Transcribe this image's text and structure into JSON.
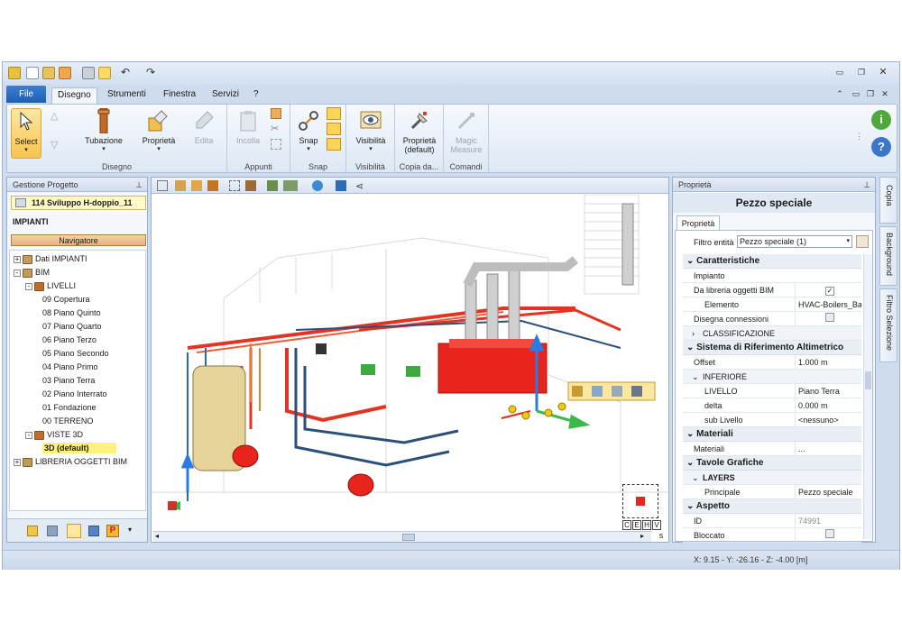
{
  "quick_access": {
    "icons": [
      "app-icon",
      "new-icon",
      "open-icon",
      "save-icon",
      "print-icon",
      "select-icon",
      "undo-icon",
      "redo-icon"
    ]
  },
  "tabs": {
    "file": "File",
    "items": [
      "Disegno",
      "Strumenti",
      "Finestra",
      "Servizi",
      "?"
    ]
  },
  "ribbon": {
    "select": "Select",
    "tubazione": "Tubazione",
    "proprieta": "Proprietà",
    "edita": "Edita",
    "disegno_group": "Disegno",
    "incolla": "Incolla",
    "appunti_group": "Appunti",
    "snap": "Snap",
    "snap_group": "Snap",
    "visibilita": "Visibilità",
    "visibilita_group": "Visibilità",
    "proprieta_default_1": "Proprietà",
    "proprieta_default_2": "(default)",
    "copia_group": "Copia da...",
    "magic_1": "Magic",
    "magic_2": "Measure",
    "comandi_group": "Comandi"
  },
  "project_panel": {
    "title": "Gestione Progetto",
    "project_name": "114 Sviluppo H-doppio_11",
    "section": "IMPIANTI",
    "navigator": "Navigatore",
    "tree": [
      {
        "label": "Dati IMPIANTI",
        "level": 0,
        "exp": "+"
      },
      {
        "label": "BIM",
        "level": 0,
        "exp": "-"
      },
      {
        "label": "LIVELLI",
        "level": 1,
        "exp": "-"
      },
      {
        "label": "09 Copertura",
        "level": 2,
        "exp": ""
      },
      {
        "label": "08 Piano Quinto",
        "level": 2,
        "exp": ""
      },
      {
        "label": "07 Piano Quarto",
        "level": 2,
        "exp": ""
      },
      {
        "label": "06 Piano Terzo",
        "level": 2,
        "exp": ""
      },
      {
        "label": "05 Piano Secondo",
        "level": 2,
        "exp": ""
      },
      {
        "label": "04 Piano Primo",
        "level": 2,
        "exp": ""
      },
      {
        "label": "03 Piano Terra",
        "level": 2,
        "exp": ""
      },
      {
        "label": "02 Piano Interrato",
        "level": 2,
        "exp": ""
      },
      {
        "label": "01 Fondazione",
        "level": 2,
        "exp": ""
      },
      {
        "label": "00 TERRENO",
        "level": 2,
        "exp": ""
      },
      {
        "label": "VISTE 3D",
        "level": 1,
        "exp": "-"
      },
      {
        "label": "3D (default)",
        "level": 2,
        "exp": "",
        "selected": true
      },
      {
        "label": "LIBRERIA OGGETTI BIM",
        "level": 0,
        "exp": "+"
      }
    ]
  },
  "viewport": {
    "scroll_label": "s",
    "cube_faces": [
      "C",
      "E",
      "H",
      "V"
    ]
  },
  "properties": {
    "panel_title": "Proprietà",
    "heading": "Pezzo speciale",
    "tab": "Proprietà",
    "filter_label": "Filtro entità",
    "filter_value": "Pezzo speciale (1)",
    "rows": [
      {
        "type": "cat",
        "label": "Caratteristiche"
      },
      {
        "type": "row",
        "k": "Impianto",
        "v": ""
      },
      {
        "type": "row",
        "k": "Da libreria oggetti BIM",
        "v": "✓",
        "chk": true
      },
      {
        "type": "row",
        "k": "Elemento",
        "v": "HVAC-Boilers_Baxi_",
        "ind": 1
      },
      {
        "type": "row",
        "k": "Disegna connessioni",
        "v": "",
        "chk": true
      },
      {
        "type": "sub",
        "k": "CLASSIFICAZIONE",
        "v": "",
        "exp": ">"
      },
      {
        "type": "cat",
        "label": "Sistema di Riferimento Altimetrico"
      },
      {
        "type": "row",
        "k": "Offset",
        "v": "1.000 m"
      },
      {
        "type": "sub",
        "k": "INFERIORE",
        "v": "",
        "exp": "v"
      },
      {
        "type": "row",
        "k": "LIVELLO",
        "v": "Piano Terra",
        "ind": 1
      },
      {
        "type": "row",
        "k": "delta",
        "v": "0.000 m",
        "ind": 1
      },
      {
        "type": "row",
        "k": "sub Livello",
        "v": "<nessuno>",
        "ind": 1
      },
      {
        "type": "cat",
        "label": "Materiali"
      },
      {
        "type": "row",
        "k": "Materiali",
        "v": "..."
      },
      {
        "type": "cat",
        "label": "Tavole Grafiche"
      },
      {
        "type": "sub",
        "k": "LAYERS",
        "v": "",
        "exp": "v",
        "bold": true
      },
      {
        "type": "row",
        "k": "Principale",
        "v": "Pezzo speciale",
        "ind": 1
      },
      {
        "type": "cat",
        "label": "Aspetto"
      },
      {
        "type": "row",
        "k": "ID",
        "v": "74991",
        "grey": true
      },
      {
        "type": "row",
        "k": "Bloccato",
        "v": "",
        "chk": true
      }
    ]
  },
  "side_tabs": [
    "Copia",
    "Background",
    "Filtro Selezione"
  ],
  "status": {
    "coords": "X: 9.15 - Y: -26.16 - Z: -4.00 [m]"
  }
}
